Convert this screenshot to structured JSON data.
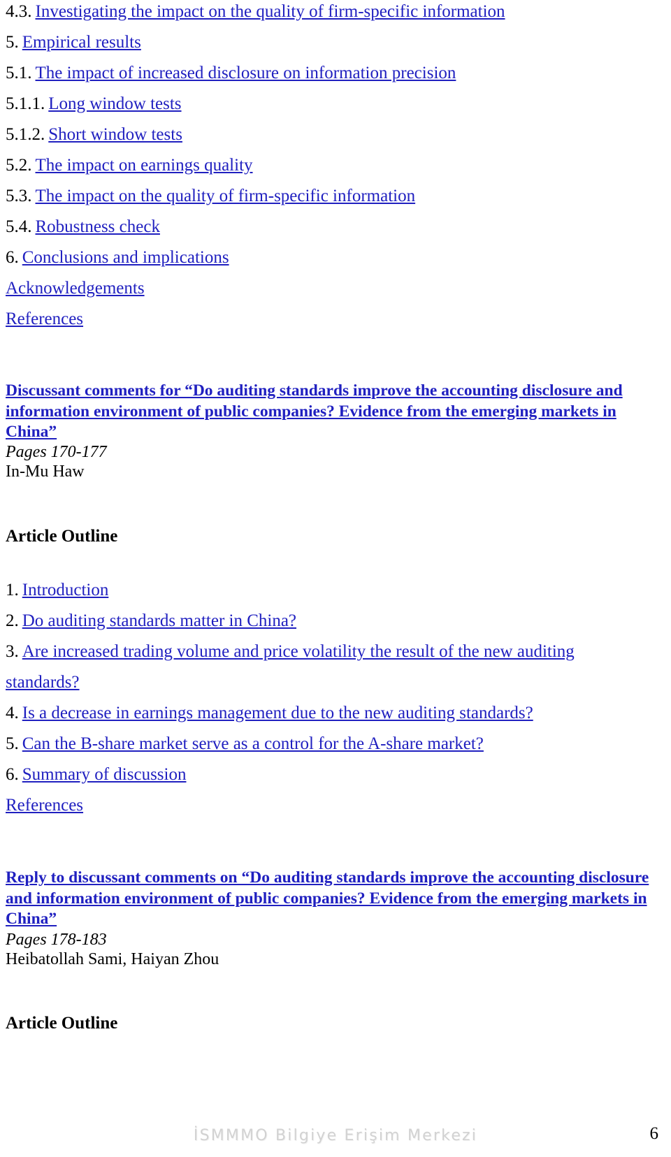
{
  "document": {
    "page_number": "6",
    "watermark": "İSMMMO Bilgiye Erişim Merkezi",
    "link_color": "#2020C0",
    "text_color": "#000000",
    "watermark_color": "#d2d2d2"
  },
  "toc_top": [
    {
      "number": "4.3.",
      "label": "Investigating the impact on the quality of firm-specific information"
    },
    {
      "number": "5.",
      "label": "Empirical results"
    },
    {
      "number": "5.1.",
      "label": "The impact of increased disclosure on information precision"
    },
    {
      "number": "5.1.1.",
      "label": "Long window tests"
    },
    {
      "number": "5.1.2.",
      "label": "Short window tests"
    },
    {
      "number": "5.2.",
      "label": "The impact on earnings quality"
    },
    {
      "number": "5.3.",
      "label": "The impact on the quality of firm-specific information"
    },
    {
      "number": "5.4.",
      "label": "Robustness check"
    },
    {
      "number": "6.",
      "label": "Conclusions and implications"
    },
    {
      "number": "",
      "label": "Acknowledgements"
    },
    {
      "number": "",
      "label": "References"
    }
  ],
  "article_one": {
    "title": "Discussant comments for “Do auditing standards improve the accounting disclosure and information environment of public companies? Evidence from the emerging markets in China”",
    "pages": "Pages 170-177",
    "authors": "In-Mu Haw",
    "outline_heading": "Article Outline",
    "outline": [
      {
        "number": "1.",
        "label": "Introduction",
        "continuation": ""
      },
      {
        "number": "2.",
        "label": "Do auditing standards matter in China?",
        "continuation": ""
      },
      {
        "number": "3.",
        "label": "Are increased trading volume and price volatility the result of the new auditing",
        "continuation": "standards?"
      },
      {
        "number": "4.",
        "label": "Is a decrease in earnings management due to the new auditing standards?",
        "continuation": ""
      },
      {
        "number": "5.",
        "label": "Can the B-share market serve as a control for the A-share market?",
        "continuation": ""
      },
      {
        "number": "6.",
        "label": "Summary of discussion",
        "continuation": ""
      },
      {
        "number": "",
        "label": "References",
        "continuation": ""
      }
    ]
  },
  "article_two": {
    "title": "Reply to discussant comments on “Do auditing standards improve the accounting disclosure and information environment of public companies? Evidence from the emerging markets in China”",
    "pages": "Pages 178-183",
    "authors": "Heibatollah Sami, Haiyan Zhou",
    "outline_heading": "Article Outline"
  }
}
